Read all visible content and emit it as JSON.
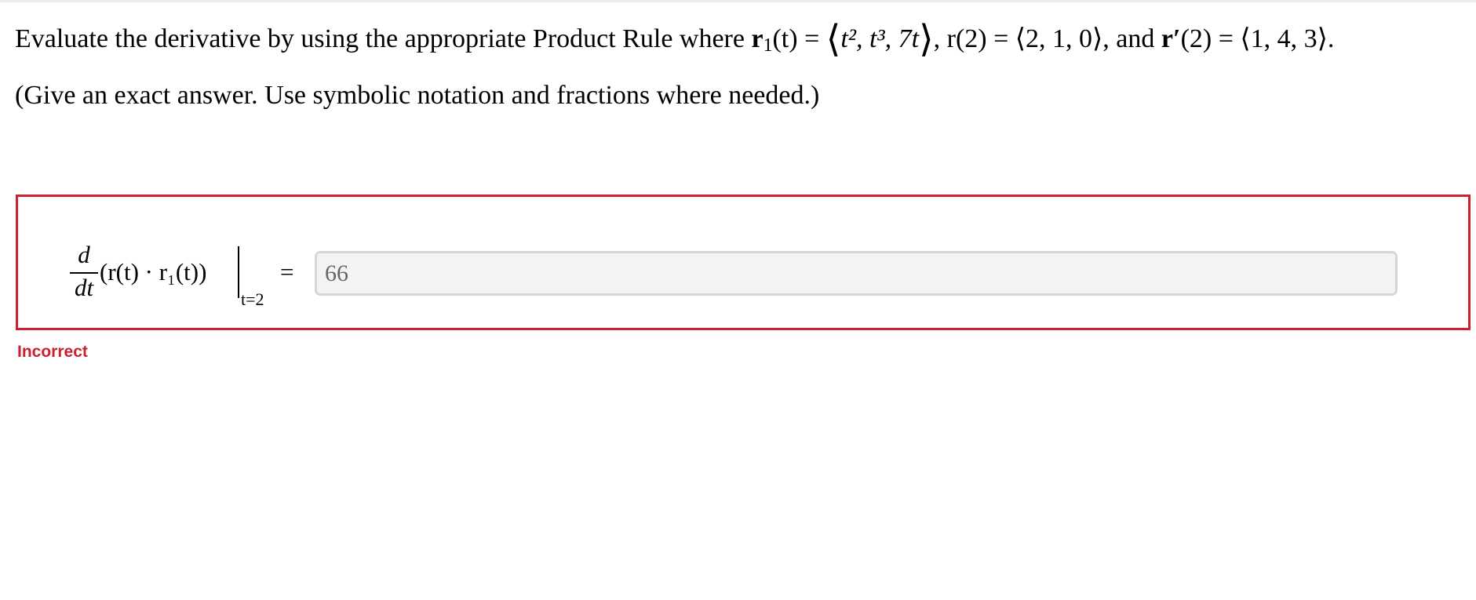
{
  "question": {
    "intro": "Evaluate the derivative by using the appropriate Product Rule where",
    "r1_symbol": "r",
    "r1_sub": "1",
    "r1_arg": "(t) = ",
    "r1_vector": "t², t³, 7t",
    "r_at_2": "r(2) = ⟨2, 1, 0⟩, and",
    "rprime_symbol": "r′",
    "rprime_value": "(2) = ⟨1, 4, 3⟩."
  },
  "instruction": "(Give an exact answer. Use symbolic notation and fractions where needed.)",
  "expression": {
    "frac_num": "d",
    "frac_den": "dt",
    "body": "(r(t) · r₁(t))",
    "eval_at": "t=2",
    "equals": "="
  },
  "answer": {
    "value": "66"
  },
  "status": {
    "label": "Incorrect",
    "color": "#cc1f2f"
  }
}
